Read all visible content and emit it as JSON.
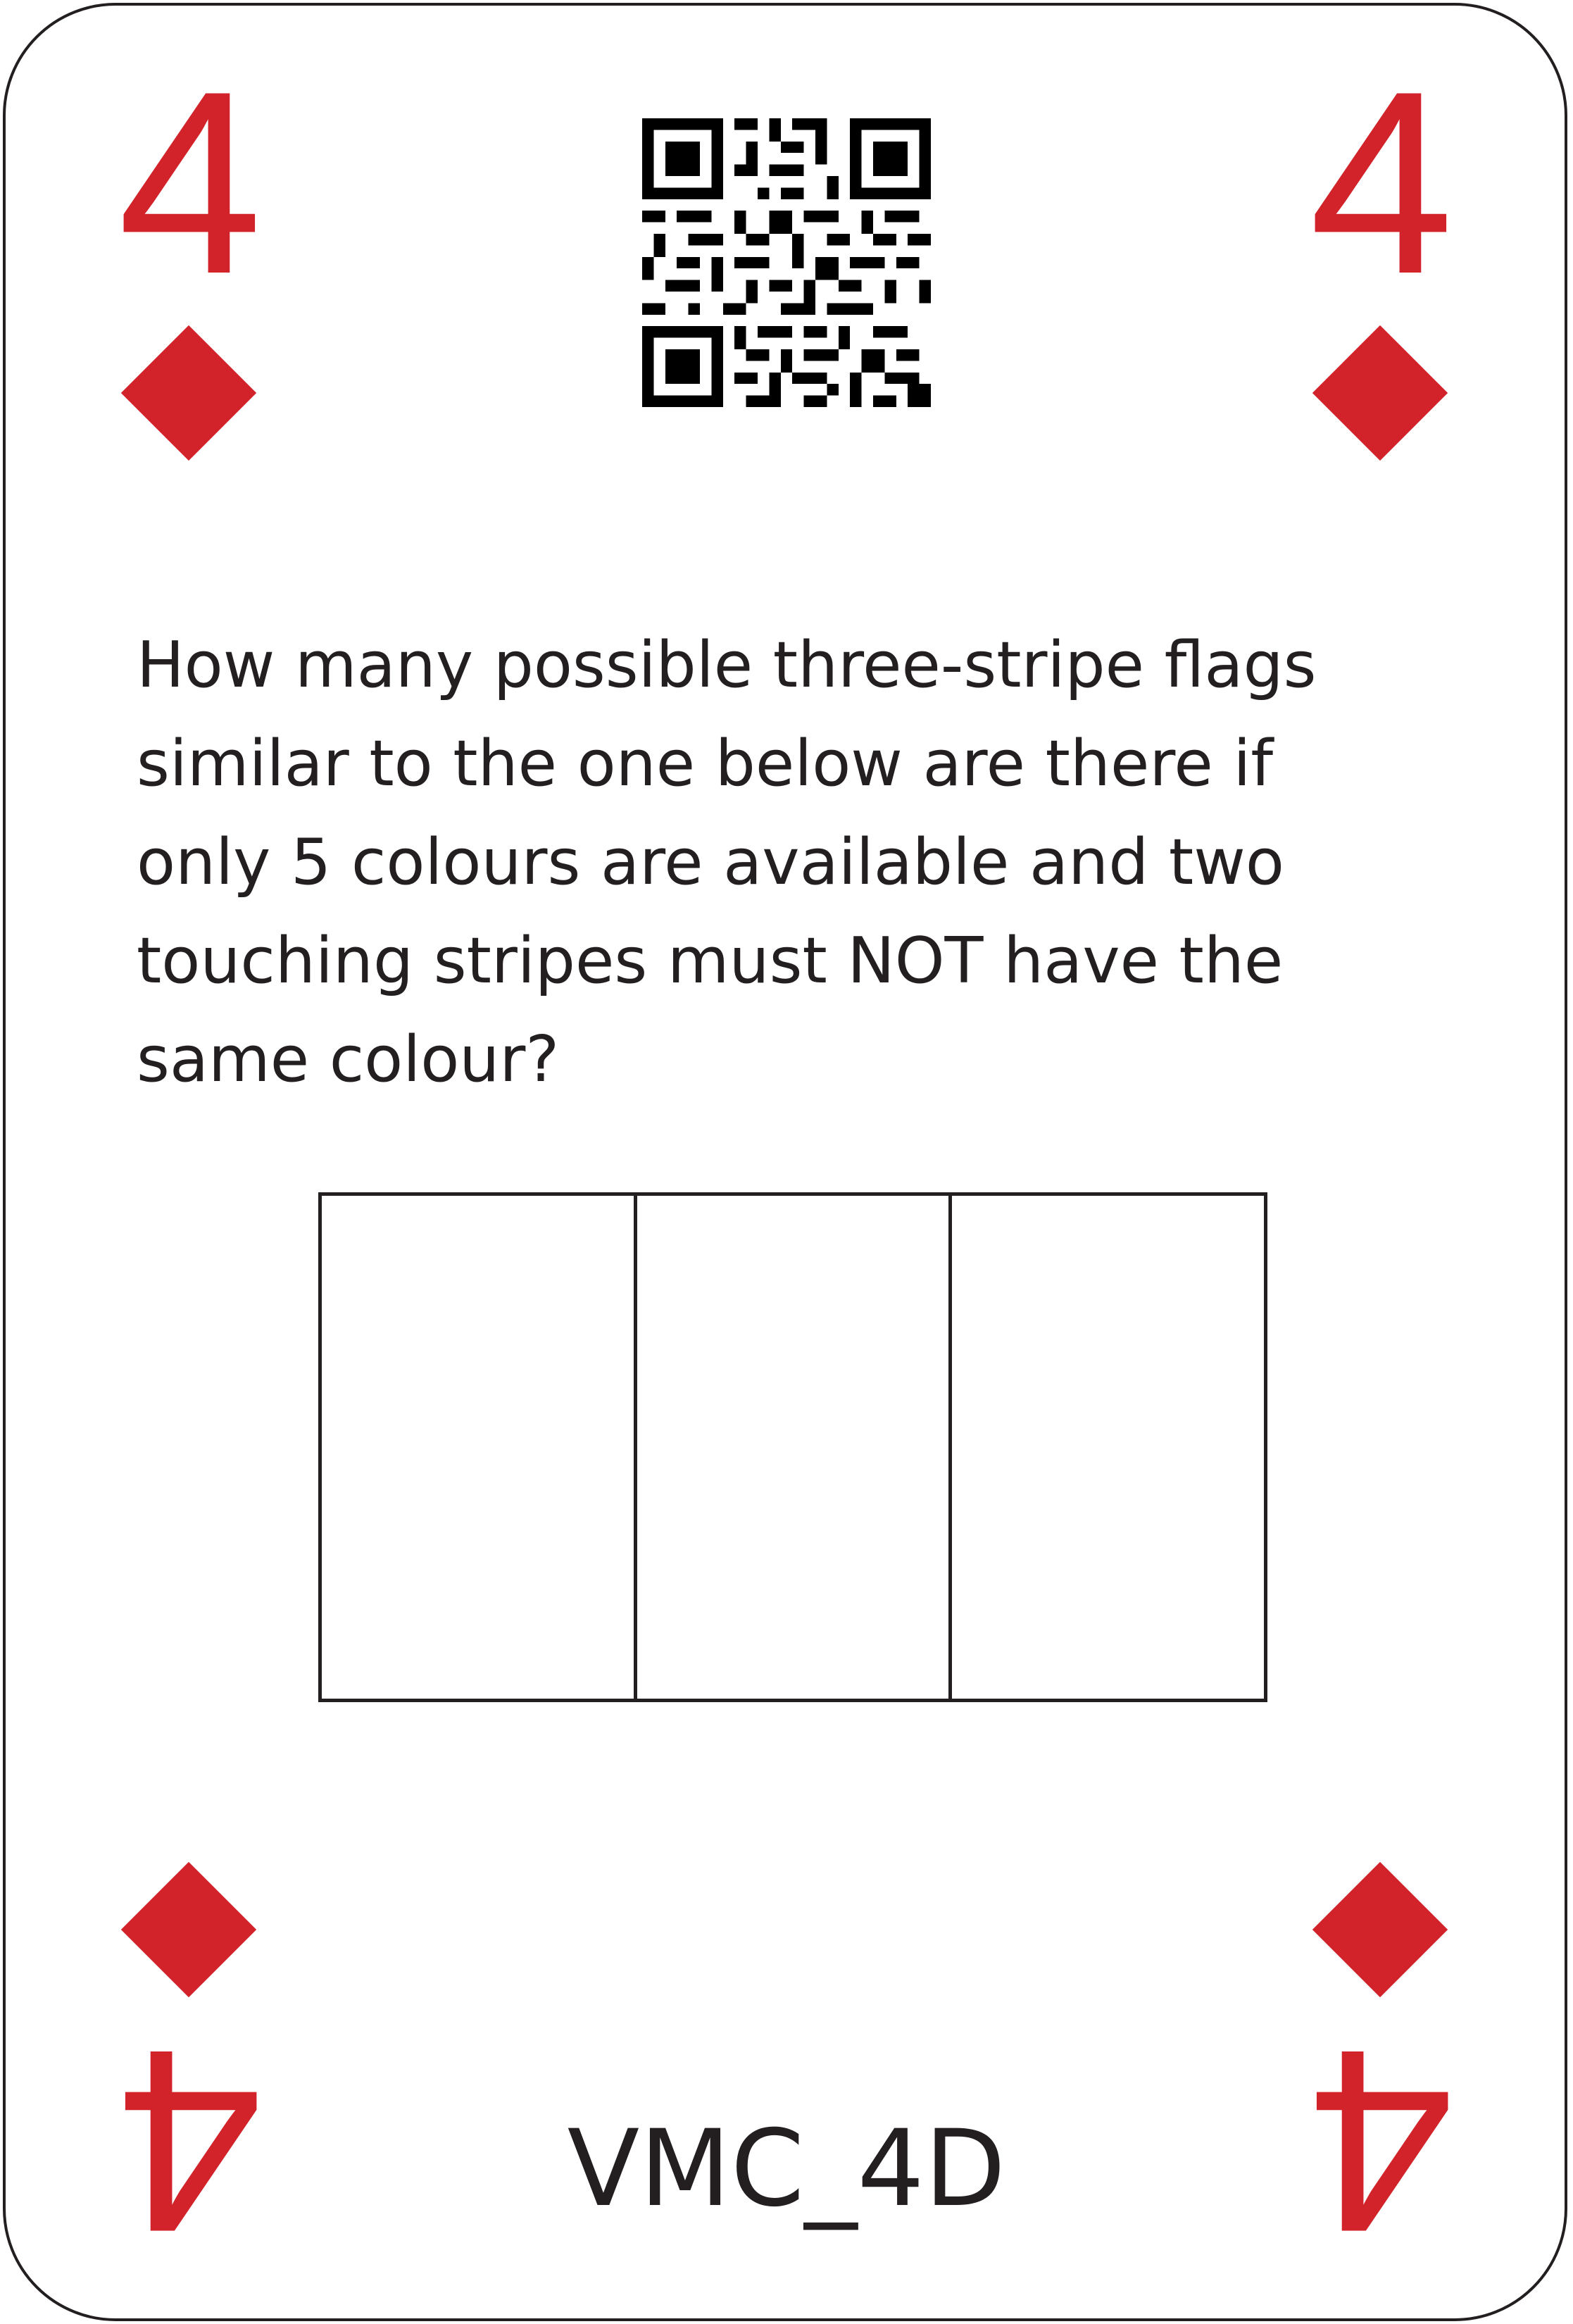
{
  "card": {
    "rank": "4",
    "suit_icon": "diamond-icon",
    "suit_color": "#d2232a",
    "question": "How many possible three-stripe flags similar to the one below are there if only 5 colours are available and two touching stripes must NOT have the same colour?",
    "code": "VMC_4D"
  },
  "qr_icon": "qr-code-icon",
  "flag": {
    "stripes": 3
  }
}
